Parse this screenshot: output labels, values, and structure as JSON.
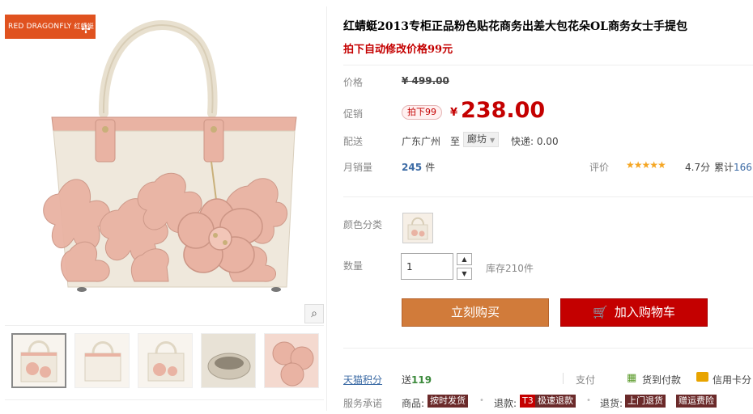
{
  "brand": {
    "logo_en": "RED DRAGONFLY",
    "logo_cn": "红蜻蜓"
  },
  "gallery": {
    "thumbs": [
      "thumb-1",
      "thumb-2",
      "thumb-3",
      "thumb-4",
      "thumb-5"
    ]
  },
  "product": {
    "title": "红蜻蜓2013专柜正品粉色贴花商务出差大包花朵OL商务女士手提包",
    "subtitle": "拍下自动修改价格99元"
  },
  "price": {
    "label": "价格",
    "original": "¥ 499.00",
    "promo_label": "促销",
    "promo_tag": "拍下99",
    "currency": "¥",
    "current": "238.00"
  },
  "shipping": {
    "label": "配送",
    "from": "广东广州",
    "to_label": "至",
    "to": "廊坊",
    "express": "快递: 0.00"
  },
  "sales": {
    "label": "月销量",
    "count": "245",
    "unit": "件",
    "review_label": "评价",
    "stars": "★★★★★",
    "score": "4.7分",
    "cumulative_label": "累计",
    "cumulative": "166"
  },
  "options": {
    "color_label": "颜色分类",
    "qty_label": "数量",
    "qty_value": "1",
    "stock": "库存210件"
  },
  "actions": {
    "buy_now": "立刻购买",
    "add_cart": "加入购物车"
  },
  "services": {
    "points_label": "天猫积分",
    "points_prefix": "送",
    "points": "119",
    "pay_label": "支付",
    "cod": "货到付款",
    "card": "信用卡分",
    "promise_label": "服务承诺",
    "goods_label": "商品:",
    "goods_badge": "按时发货",
    "refund_label": "退款:",
    "refund_badge_t3": "T3",
    "refund_badge": "极速退款",
    "return_label": "退货:",
    "return_badge": "上门退货",
    "insurance_badge": "赠运费险"
  },
  "colors": {
    "accent_red": "#c40000",
    "buy_orange": "#d17b3a",
    "link_blue": "#3c6ba5",
    "brand_orange": "#e0521f",
    "bag_pink": "#e9b3a3",
    "bag_cream": "#efe8dc"
  },
  "icons": [
    "zoom-icon",
    "dragonfly-icon",
    "cart-icon",
    "cod-icon",
    "credit-card-icon",
    "stepper-up-icon",
    "stepper-down-icon",
    "dropdown-caret-icon"
  ]
}
